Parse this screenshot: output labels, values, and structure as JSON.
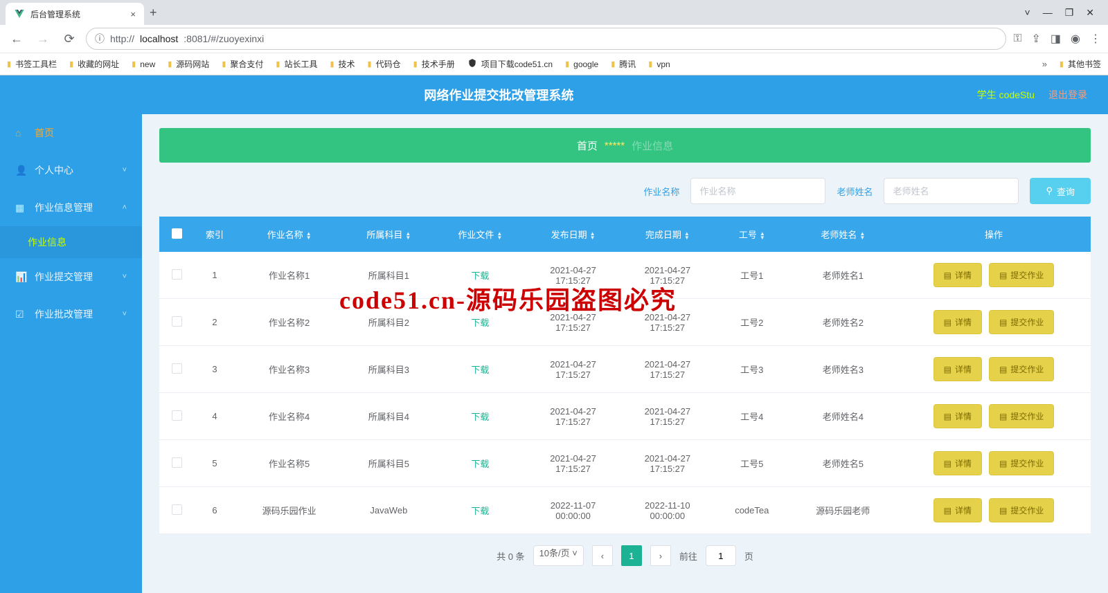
{
  "browser": {
    "tab_title": "后台管理系统",
    "url_prefix": "http://",
    "url_host": "localhost",
    "url_path": ":8081/#/zuoyexinxi",
    "bookmarks": [
      "书签工具栏",
      "收藏的网址",
      "new",
      "源码网站",
      "聚合支付",
      "站长工具",
      "技术",
      "代码仓",
      "技术手册",
      "项目下载code51.cn",
      "google",
      "腾讯",
      "vpn"
    ],
    "other_bookmarks": "其他书签"
  },
  "header": {
    "title": "网络作业提交批改管理系统",
    "user_role": "学生",
    "user_name": "codeStu",
    "logout": "退出登录"
  },
  "sidebar": {
    "items": [
      {
        "icon": "home",
        "label": "首页",
        "type": "link"
      },
      {
        "icon": "user",
        "label": "个人中心",
        "type": "sub",
        "chev": "˅"
      },
      {
        "icon": "grid",
        "label": "作业信息管理",
        "type": "sub",
        "chev": "˄"
      },
      {
        "label": "作业信息",
        "type": "active-sub"
      },
      {
        "icon": "bars",
        "label": "作业提交管理",
        "type": "sub",
        "chev": "˅"
      },
      {
        "icon": "check",
        "label": "作业批改管理",
        "type": "sub",
        "chev": "˅"
      }
    ]
  },
  "breadcrumb": {
    "home": "首页",
    "stars": "*****",
    "current": "作业信息"
  },
  "search": {
    "label1": "作业名称",
    "placeholder1": "作业名称",
    "label2": "老师姓名",
    "placeholder2": "老师姓名",
    "button": "查询"
  },
  "table": {
    "headers": [
      "",
      "索引",
      "作业名称",
      "所属科目",
      "作业文件",
      "发布日期",
      "完成日期",
      "工号",
      "老师姓名",
      "操作"
    ],
    "download_label": "下载",
    "op_detail": "详情",
    "op_submit": "提交作业",
    "rows": [
      {
        "idx": "1",
        "name": "作业名称1",
        "subject": "所属科目1",
        "pub": "2021-04-27 17:15:27",
        "due": "2021-04-27 17:15:27",
        "tno": "工号1",
        "tname": "老师姓名1"
      },
      {
        "idx": "2",
        "name": "作业名称2",
        "subject": "所属科目2",
        "pub": "2021-04-27 17:15:27",
        "due": "2021-04-27 17:15:27",
        "tno": "工号2",
        "tname": "老师姓名2"
      },
      {
        "idx": "3",
        "name": "作业名称3",
        "subject": "所属科目3",
        "pub": "2021-04-27 17:15:27",
        "due": "2021-04-27 17:15:27",
        "tno": "工号3",
        "tname": "老师姓名3"
      },
      {
        "idx": "4",
        "name": "作业名称4",
        "subject": "所属科目4",
        "pub": "2021-04-27 17:15:27",
        "due": "2021-04-27 17:15:27",
        "tno": "工号4",
        "tname": "老师姓名4"
      },
      {
        "idx": "5",
        "name": "作业名称5",
        "subject": "所属科目5",
        "pub": "2021-04-27 17:15:27",
        "due": "2021-04-27 17:15:27",
        "tno": "工号5",
        "tname": "老师姓名5"
      },
      {
        "idx": "6",
        "name": "源码乐园作业",
        "subject": "JavaWeb",
        "pub": "2022-11-07 00:00:00",
        "due": "2022-11-10 00:00:00",
        "tno": "codeTea",
        "tname": "源码乐园老师"
      }
    ]
  },
  "pagination": {
    "total": "共 0 条",
    "size": "10条/页",
    "page": "1",
    "goto": "前往",
    "goto_val": "1",
    "suffix": "页"
  },
  "watermark": "code51.cn-源码乐园盗图必究"
}
